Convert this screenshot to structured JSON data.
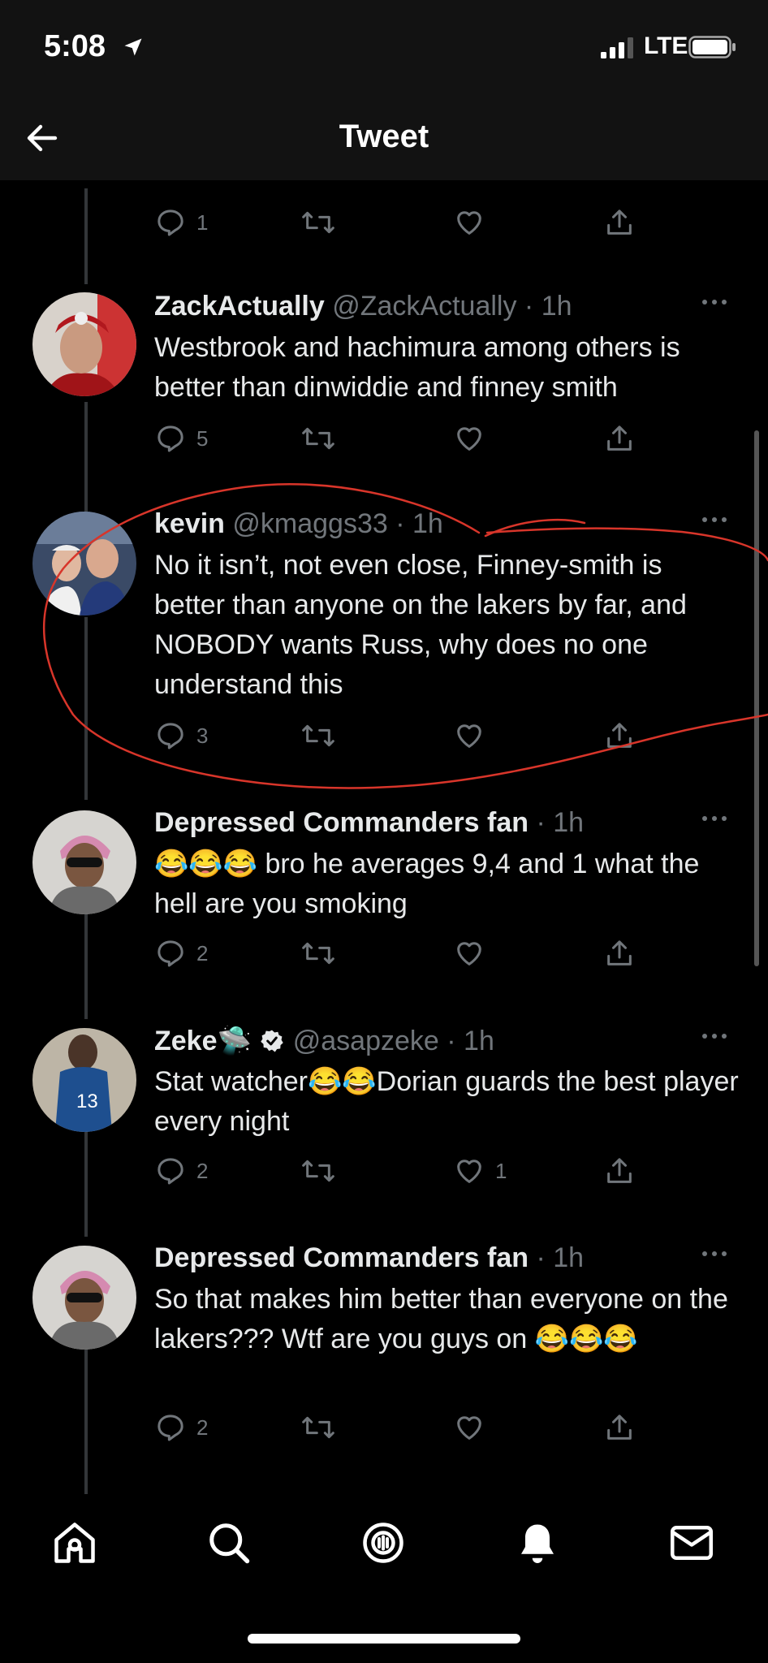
{
  "status_bar": {
    "time": "5:08",
    "network": "LTE"
  },
  "nav": {
    "title": "Tweet"
  },
  "top_actions": {
    "reply_count": "1"
  },
  "tweets": [
    {
      "name": "ZackActually",
      "handle": "@ZackActually",
      "time": "1h",
      "text": "Westbrook and hachimura among others is better than dinwiddie and finney smith",
      "replies": "5",
      "retweets": "",
      "likes": ""
    },
    {
      "name": "kevin",
      "handle": "@kmaggs33",
      "time": "1h",
      "text": "No it isn’t, not even close, Finney-smith is better than anyone on the lakers by far, and NOBODY wants Russ, why does no one understand this",
      "replies": "3",
      "retweets": "",
      "likes": ""
    },
    {
      "name": "Depressed Commanders fan",
      "handle": "",
      "time": "1h",
      "text": "😂😂😂 bro he averages 9,4 and 1 what the hell are you smoking",
      "replies": "2",
      "retweets": "",
      "likes": ""
    },
    {
      "name": "Zeke",
      "name_emoji": "🛸",
      "handle": "@asapzeke",
      "time": "1h",
      "text": "Stat watcher😂😂Dorian guards the best player every night",
      "replies": "2",
      "retweets": "",
      "likes": "1"
    },
    {
      "name": "Depressed Commanders fan",
      "handle": "",
      "time": "1h",
      "text": "So that makes him better than everyone on the lakers??? Wtf are you guys on 😂😂😂",
      "replies": "2",
      "retweets": "",
      "likes": ""
    }
  ],
  "colors": {
    "background": "#000000",
    "text": "#e7e9ea",
    "secondary": "#71767b",
    "verified": "#e7e9ea",
    "annotation": "#d8352a"
  },
  "icons": [
    "back-arrow-icon",
    "reply-icon",
    "retweet-icon",
    "like-icon",
    "share-icon",
    "more-icon",
    "home-icon",
    "search-icon",
    "spaces-icon",
    "notifications-icon",
    "messages-icon"
  ]
}
